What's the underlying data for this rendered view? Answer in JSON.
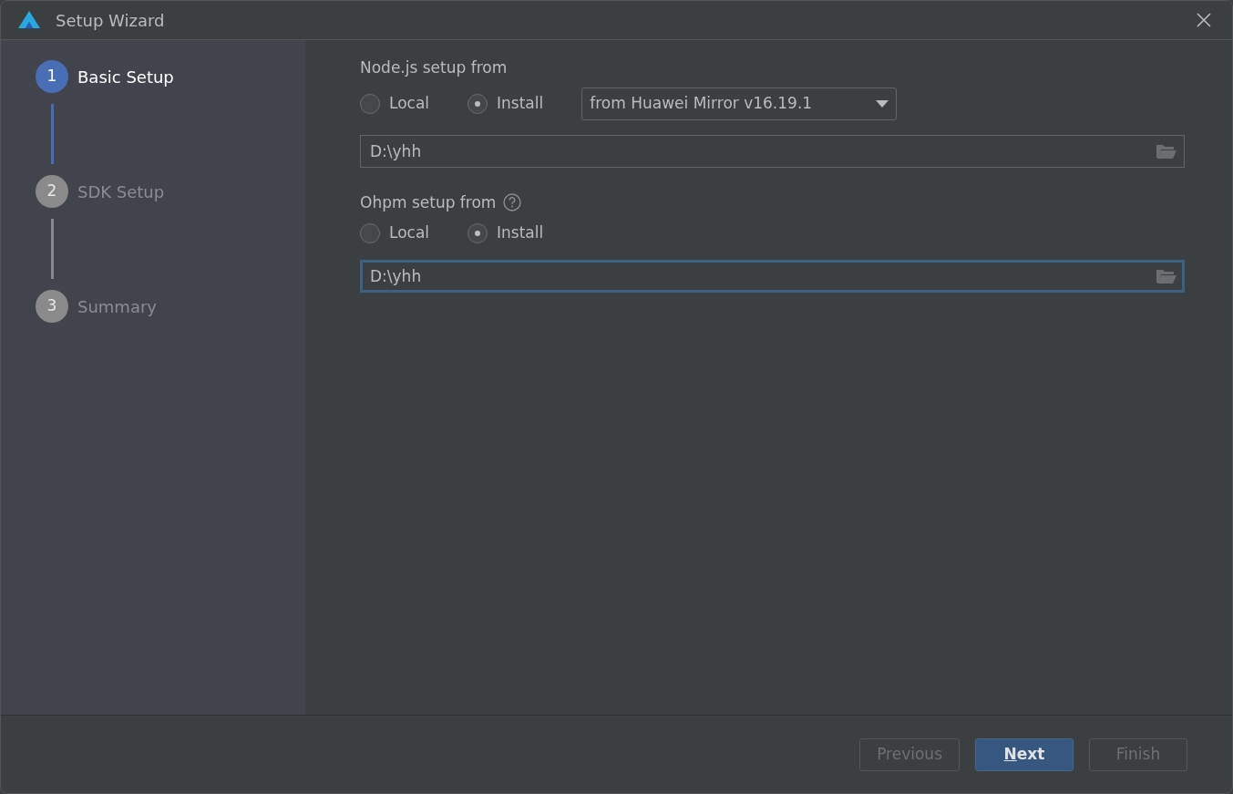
{
  "window": {
    "title": "Setup Wizard"
  },
  "steps": [
    {
      "number": "1",
      "label": "Basic Setup",
      "selected": true
    },
    {
      "number": "2",
      "label": "SDK Setup",
      "selected": false
    },
    {
      "number": "3",
      "label": "Summary",
      "selected": false
    }
  ],
  "sections": [
    {
      "title": "Node.js setup from",
      "help": false,
      "options": [
        {
          "label": "Local",
          "selected": false
        },
        {
          "label": "Install",
          "selected": true
        }
      ],
      "dropdown": {
        "value": "from Huawei Mirror v16.19.1"
      },
      "path": {
        "value": "D:\\yhh",
        "focused": false
      }
    },
    {
      "title": "Ohpm setup from",
      "help": true,
      "options": [
        {
          "label": "Local",
          "selected": false
        },
        {
          "label": "Install",
          "selected": true
        }
      ],
      "path": {
        "value": "D:\\yhh",
        "focused": true
      }
    }
  ],
  "buttons": [
    {
      "label": "Previous",
      "disabled": true,
      "primary": false,
      "mnemonic_first": false
    },
    {
      "label": "Next",
      "disabled": false,
      "primary": true,
      "mnemonic_first": true
    },
    {
      "label": "Finish",
      "disabled": true,
      "primary": false,
      "mnemonic_first": false
    }
  ]
}
